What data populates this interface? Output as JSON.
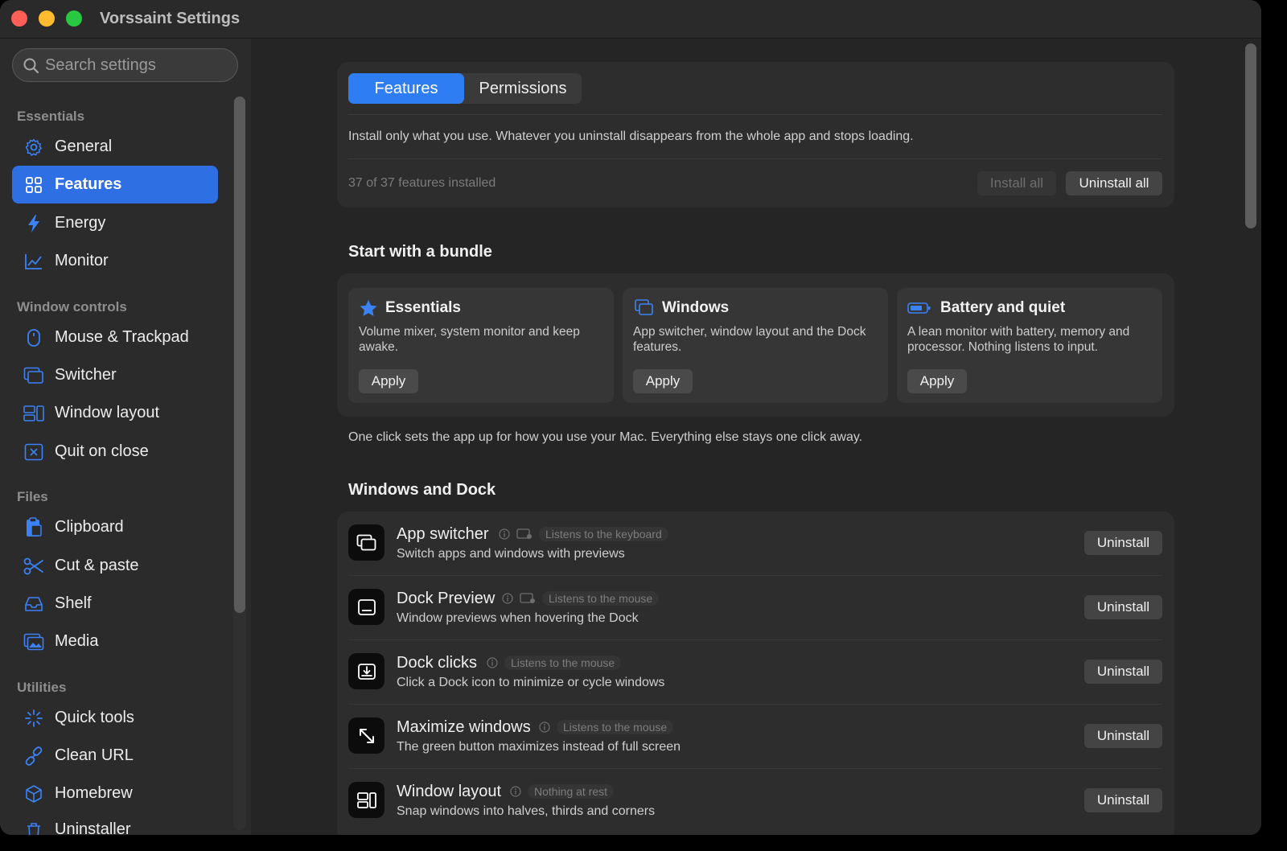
{
  "window": {
    "title": "Vorssaint Settings"
  },
  "sidebar": {
    "search_placeholder": "Search settings",
    "sections": [
      {
        "label": "Essentials",
        "items": [
          {
            "label": "General",
            "icon": "gear-icon"
          },
          {
            "label": "Features",
            "icon": "grid-icon",
            "active": true
          },
          {
            "label": "Energy",
            "icon": "bolt-icon"
          },
          {
            "label": "Monitor",
            "icon": "chart-icon"
          }
        ]
      },
      {
        "label": "Window controls",
        "items": [
          {
            "label": "Mouse & Trackpad",
            "icon": "mouse-icon"
          },
          {
            "label": "Switcher",
            "icon": "switcher-icon"
          },
          {
            "label": "Window layout",
            "icon": "layout-icon"
          },
          {
            "label": "Quit on close",
            "icon": "x-box-icon"
          }
        ]
      },
      {
        "label": "Files",
        "items": [
          {
            "label": "Clipboard",
            "icon": "clipboard-icon"
          },
          {
            "label": "Cut & paste",
            "icon": "scissors-icon"
          },
          {
            "label": "Shelf",
            "icon": "tray-icon"
          },
          {
            "label": "Media",
            "icon": "photo-icon"
          }
        ]
      },
      {
        "label": "Utilities",
        "items": [
          {
            "label": "Quick tools",
            "icon": "sparkle-icon"
          },
          {
            "label": "Clean URL",
            "icon": "link-icon"
          },
          {
            "label": "Homebrew",
            "icon": "cube-icon"
          },
          {
            "label": "Uninstaller",
            "icon": "trash-icon"
          }
        ]
      }
    ]
  },
  "main": {
    "tabs": [
      "Features",
      "Permissions"
    ],
    "active_tab": "Features",
    "intro": "Install only what you use. Whatever you uninstall disappears from the whole app and stops loading.",
    "installed_count": "37 of 37 features installed",
    "install_all": "Install all",
    "uninstall_all": "Uninstall all",
    "bundle_heading": "Start with a bundle",
    "bundles": [
      {
        "title": "Essentials",
        "icon": "star-icon",
        "desc": "Volume mixer, system monitor and keep awake.",
        "button": "Apply"
      },
      {
        "title": "Windows",
        "icon": "windows-icon",
        "desc": "App switcher, window layout and the Dock features.",
        "button": "Apply"
      },
      {
        "title": "Battery and quiet",
        "icon": "battery-icon",
        "desc": "A lean monitor with battery, memory and processor. Nothing listens to input.",
        "button": "Apply"
      }
    ],
    "bundle_note": "One click sets the app up for how you use your Mac. Everything else stays one click away.",
    "windows_heading": "Windows and Dock",
    "features": [
      {
        "title": "App switcher",
        "icon": "app-switcher-icon",
        "pill": "Listens to the keyboard",
        "has_screen_icon": true,
        "desc": "Switch apps and windows with previews",
        "button": "Uninstall"
      },
      {
        "title": "Dock Preview",
        "icon": "dock-preview-icon",
        "pill": "Listens to the mouse",
        "has_screen_icon": true,
        "desc": "Window previews when hovering the Dock",
        "button": "Uninstall"
      },
      {
        "title": "Dock clicks",
        "icon": "dock-clicks-icon",
        "pill": "Listens to the mouse",
        "has_screen_icon": false,
        "desc": "Click a Dock icon to minimize or cycle windows",
        "button": "Uninstall"
      },
      {
        "title": "Maximize windows",
        "icon": "maximize-icon",
        "pill": "Listens to the mouse",
        "has_screen_icon": false,
        "desc": "The green button maximizes instead of full screen",
        "button": "Uninstall"
      },
      {
        "title": "Window layout",
        "icon": "window-layout-icon",
        "pill": "Nothing at rest",
        "has_screen_icon": false,
        "desc": "Snap windows into halves, thirds and corners",
        "button": "Uninstall"
      }
    ]
  },
  "colors": {
    "accent": "#2f6fe4",
    "background": "#252526",
    "sidebar": "#2b2b2b",
    "card": "#2d2d2d"
  }
}
